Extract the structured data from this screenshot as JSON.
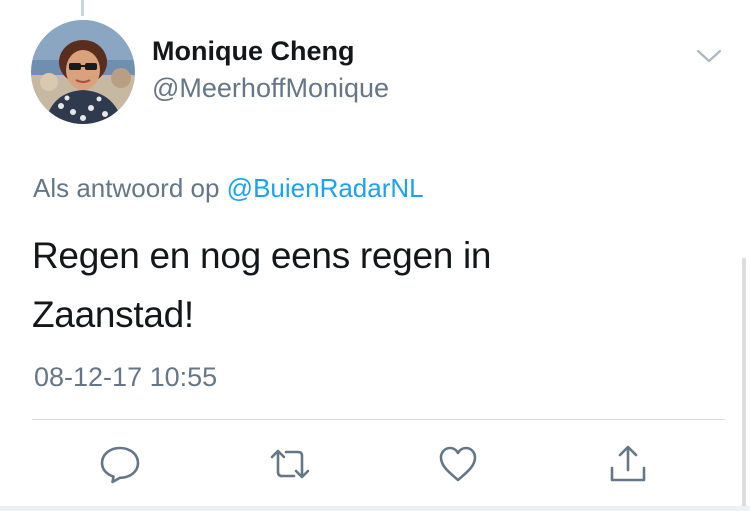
{
  "tweet": {
    "author": {
      "display_name": "Monique Cheng",
      "handle": "@MeerhoffMonique",
      "avatar_icon": "profile-photo"
    },
    "reply_context": {
      "prefix": "Als antwoord op ",
      "mention": "@BuienRadarNL"
    },
    "text_line_1": "Regen en nog eens regen in",
    "text_line_2": "Zaanstad!",
    "timestamp": "08-12-17 10:55"
  },
  "actions": [
    {
      "name": "reply",
      "icon": "speech-bubble-icon"
    },
    {
      "name": "retweet",
      "icon": "retweet-icon"
    },
    {
      "name": "like",
      "icon": "heart-icon"
    },
    {
      "name": "share",
      "icon": "share-icon"
    }
  ],
  "colors": {
    "text_primary": "#14171a",
    "text_secondary": "#657786",
    "link": "#1da1f2",
    "icon": "#657786",
    "divider": "#d6dde3"
  }
}
